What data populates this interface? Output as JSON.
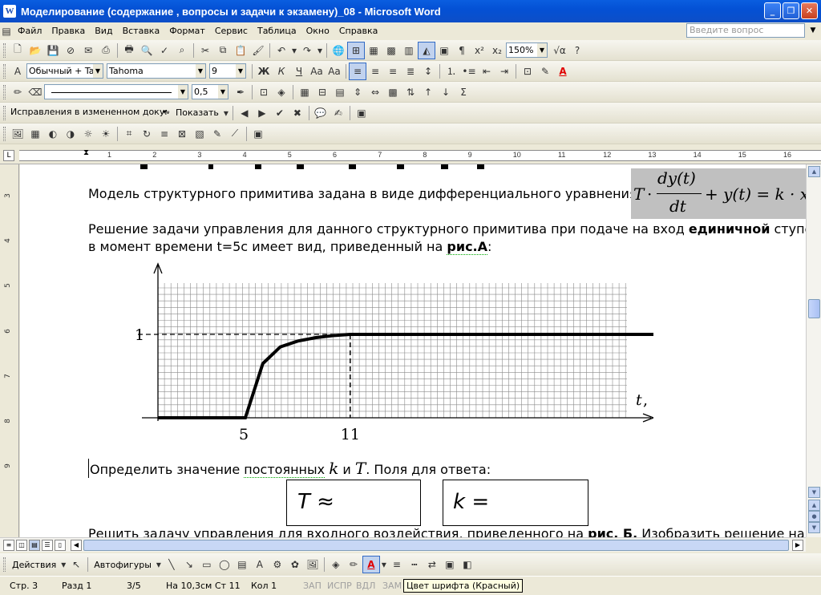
{
  "window": {
    "title": "Моделирование (содержание , вопросы и задачи к экзамену)_08 - Microsoft Word",
    "app_icon": "W"
  },
  "menu": {
    "items": [
      "Файл",
      "Правка",
      "Вид",
      "Вставка",
      "Формат",
      "Сервис",
      "Таблица",
      "Окно",
      "Справка"
    ],
    "ask_placeholder": "Введите вопрос"
  },
  "toolbar_standard": {
    "zoom": "150%"
  },
  "toolbar_format": {
    "style": "Обычный + Tah",
    "font": "Tahoma",
    "size": "9"
  },
  "toolbar_drawing_top": {
    "line_width": "0,5"
  },
  "toolbar_review": {
    "mode": "Исправления в измененном документ",
    "show": "Показать"
  },
  "draw_bar": {
    "actions": "Действия",
    "autoshapes": "Автофигуры"
  },
  "status": {
    "page": "Стр. 3",
    "section": "Разд 1",
    "pages": "3/5",
    "at": "На 10,3см",
    "line": "Ст 11",
    "col": "Кол 1",
    "rec": "ЗАП",
    "trk": "ИСПР",
    "ext": "ВДЛ",
    "ovr": "ЗАМ"
  },
  "tooltip": "Цвет шрифта (Красный)",
  "ruler_numbers": [
    "1",
    "2",
    "3",
    "4",
    "5",
    "6",
    "7",
    "8",
    "9",
    "10",
    "11",
    "12",
    "13",
    "14",
    "15",
    "16"
  ],
  "vruler_numbers": [
    "3",
    "4",
    "5",
    "6",
    "7",
    "8",
    "9"
  ],
  "document": {
    "line1": "Модель структурного примитива задана в виде дифференциального уравнения:",
    "formula": {
      "T": "T",
      "dot": "·",
      "num": "dy(t)",
      "den": "dt",
      "rest": "+ y(t) = k · x"
    },
    "line2_pre": "Решение задачи управления для данного структурного примитива при подаче на вход ",
    "line2_bold": "единичной",
    "line2_post": " ступени",
    "line3_pre": "в момент времени t=5с имеет вид, приведенный на ",
    "line3_bold": "рис.А",
    "line3_post": ":",
    "line4_pre": "Определить значение ",
    "line4_u": "постоянных",
    "line4_k": "k",
    "line4_and": "и",
    "line4_T": "T",
    "line4_post": ". Поля для ответа:",
    "answer_T": "T ≈",
    "answer_k": "k =",
    "line5_pre": "Решить задачу управления для входного воздействия, приведенного на ",
    "line5_bold": "рис. Б.",
    "line5_post": " Изобразить решение на"
  },
  "chart_data": {
    "type": "line",
    "xlabel_t": "t",
    "xlabel_unit": ", с",
    "ylabel": "",
    "tick_x": [
      "5",
      "11"
    ],
    "tick_y": [
      "1"
    ],
    "xlim": [
      0,
      30
    ],
    "ylim": [
      0,
      1.6
    ],
    "grid": true,
    "series": [
      {
        "x": [
          0,
          2.5,
          5,
          6,
          7,
          8,
          9,
          10,
          11,
          30
        ],
        "y": [
          0,
          0,
          0,
          0.65,
          0.85,
          0.92,
          0.96,
          0.985,
          1.0,
          1.0
        ]
      }
    ],
    "guides": {
      "y1_until_x": 11,
      "x11_vertical": true
    }
  }
}
